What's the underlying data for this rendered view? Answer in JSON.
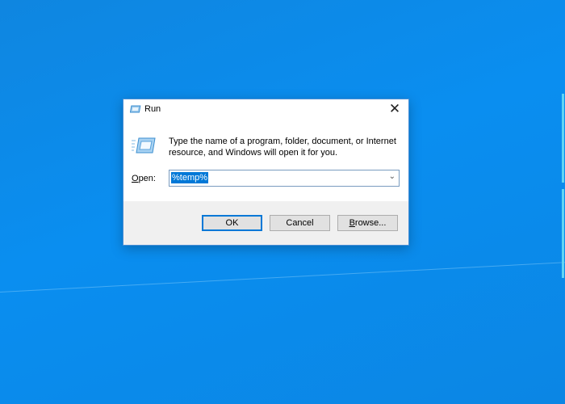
{
  "dialog": {
    "title": "Run",
    "description": "Type the name of a program, folder, document, or Internet resource, and Windows will open it for you.",
    "open_label_accel": "O",
    "open_label_rest": "pen:",
    "open_value": "%temp%",
    "buttons": {
      "ok": "OK",
      "cancel": "Cancel",
      "browse_accel": "B",
      "browse_rest": "rowse..."
    }
  },
  "colors": {
    "accent": "#0078d7",
    "desktop": "#0a8ef0"
  }
}
